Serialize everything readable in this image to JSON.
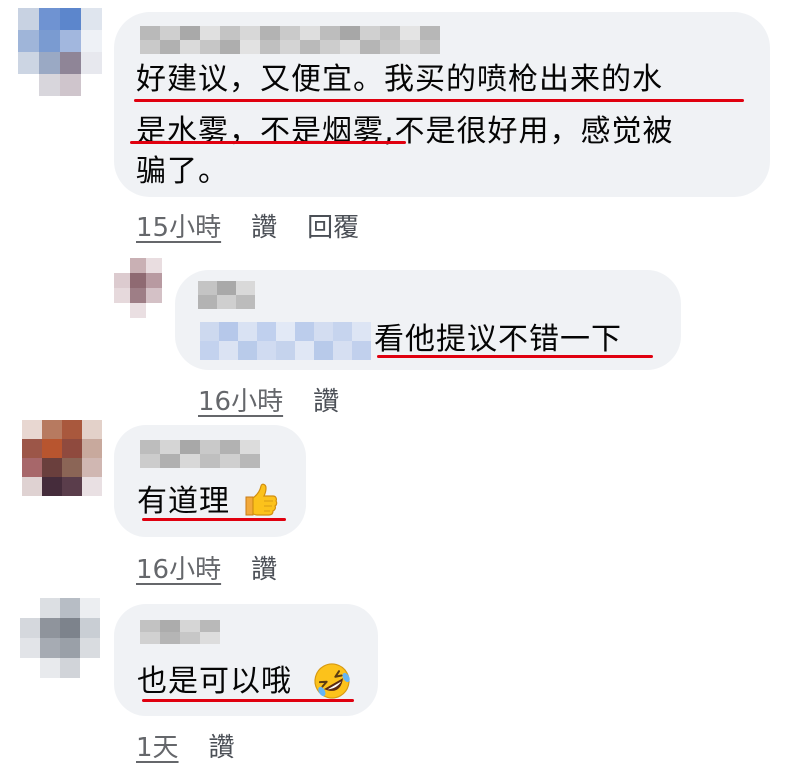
{
  "comments": [
    {
      "text_line1": "好建议，又便宜。我买的喷枪出来的水",
      "text_line2": "是水雾，不是烟雾,不是很好用，感觉被",
      "text_line3": "骗了。",
      "time": "15小時",
      "like": "讚",
      "reply": "回覆"
    },
    {
      "text": "看他提议不错一下",
      "time": "16小時",
      "like": "讚"
    },
    {
      "text": "有道理",
      "emoji": "thumbs-up-icon",
      "time": "16小時",
      "like": "讚"
    },
    {
      "text": "也是可以哦",
      "emoji": "rolling-on-floor-laughing-icon",
      "time": "1天",
      "like": "讚"
    }
  ],
  "colors": {
    "bubble": "#f0f2f5",
    "underline": "#e0000f",
    "meta_text": "#65676b"
  }
}
